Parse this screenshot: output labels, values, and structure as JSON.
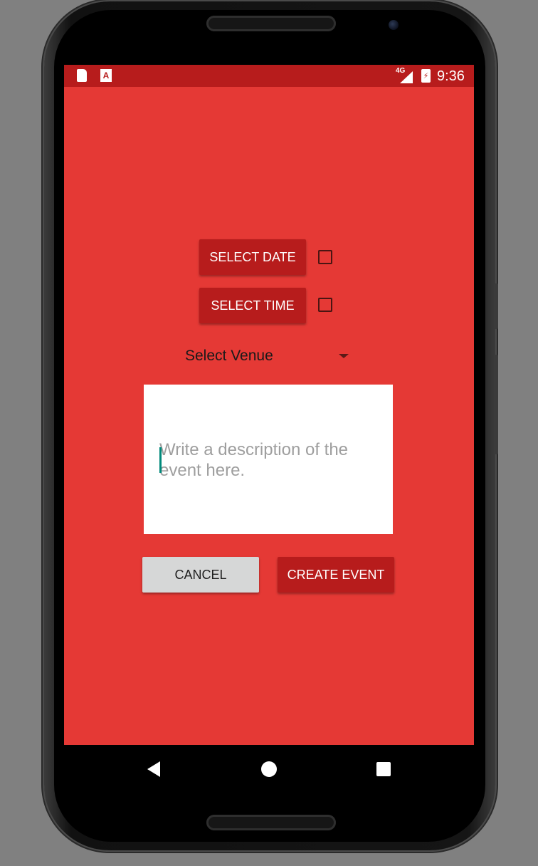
{
  "status_bar": {
    "network_label": "4G",
    "time": "9:36",
    "icons": [
      "sd-card-icon",
      "app-notification-icon",
      "signal-icon",
      "battery-charging-icon"
    ]
  },
  "form": {
    "select_date_label": "SELECT DATE",
    "select_time_label": "SELECT TIME",
    "date_checked": false,
    "time_checked": false,
    "venue_spinner": {
      "selected": "Select Venue"
    },
    "description": {
      "value": "",
      "placeholder": "Write a description of the event here."
    },
    "cancel_label": "CANCEL",
    "create_label": "CREATE EVENT"
  },
  "nav_bar": {
    "icons": [
      "back-icon",
      "home-icon",
      "recents-icon"
    ]
  },
  "colors": {
    "background": "#e53935",
    "status_bar": "#b71c1c",
    "primary_button": "#b71c1c",
    "secondary_button": "#d6d7d7",
    "accent_caret": "#00897b"
  }
}
